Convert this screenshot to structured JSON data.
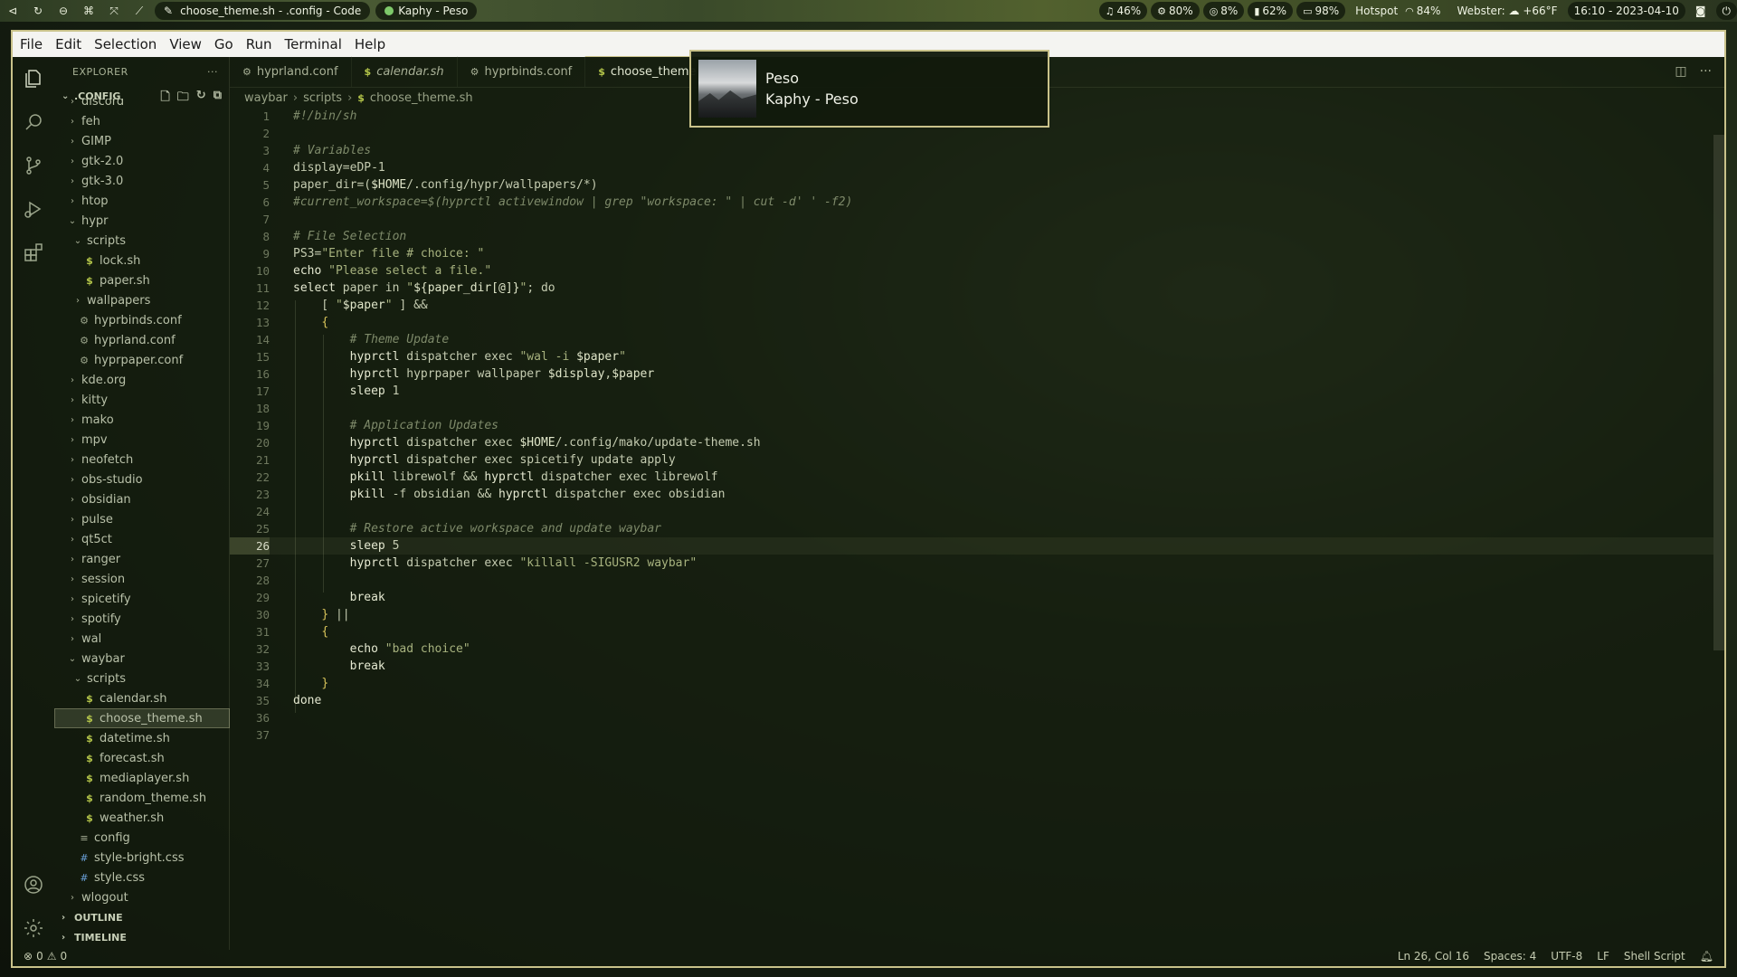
{
  "topbar": {
    "window_title": "choose_theme.sh - .config - Code",
    "player": "Kaphy - Peso",
    "modules": [
      {
        "name": "headphones",
        "icon": "♫",
        "value": "46%"
      },
      {
        "name": "cpu",
        "icon": "⚙",
        "value": "80%"
      },
      {
        "name": "memory",
        "icon": "◎",
        "value": "8%"
      },
      {
        "name": "disk",
        "icon": "▮",
        "value": "62%"
      },
      {
        "name": "battery",
        "icon": "▭",
        "value": "98%"
      }
    ],
    "hotspot": "Hotspot",
    "wifi": "84%",
    "weather": "Webster: ☁ +66°F",
    "datetime": "16:10 - 2023-04-10"
  },
  "menu": [
    "File",
    "Edit",
    "Selection",
    "View",
    "Go",
    "Run",
    "Terminal",
    "Help"
  ],
  "sidebar": {
    "header": "EXPLORER",
    "root": ".CONFIG",
    "outline": "OUTLINE",
    "timeline": "TIMELINE",
    "tree": [
      {
        "label": "discord",
        "indent": 0,
        "type": "folder",
        "open": false
      },
      {
        "label": "feh",
        "indent": 0,
        "type": "folder",
        "open": false
      },
      {
        "label": "GIMP",
        "indent": 0,
        "type": "folder",
        "open": false
      },
      {
        "label": "gtk-2.0",
        "indent": 0,
        "type": "folder",
        "open": false
      },
      {
        "label": "gtk-3.0",
        "indent": 0,
        "type": "folder",
        "open": false
      },
      {
        "label": "htop",
        "indent": 0,
        "type": "folder",
        "open": false
      },
      {
        "label": "hypr",
        "indent": 0,
        "type": "folder",
        "open": true
      },
      {
        "label": "scripts",
        "indent": 1,
        "type": "folder",
        "open": true
      },
      {
        "label": "lock.sh",
        "indent": 2,
        "type": "sh"
      },
      {
        "label": "paper.sh",
        "indent": 2,
        "type": "sh"
      },
      {
        "label": "wallpapers",
        "indent": 1,
        "type": "folder",
        "open": false
      },
      {
        "label": "hyprbinds.conf",
        "indent": 1,
        "type": "gear"
      },
      {
        "label": "hyprland.conf",
        "indent": 1,
        "type": "gear"
      },
      {
        "label": "hyprpaper.conf",
        "indent": 1,
        "type": "gear"
      },
      {
        "label": "kde.org",
        "indent": 0,
        "type": "folder",
        "open": false
      },
      {
        "label": "kitty",
        "indent": 0,
        "type": "folder",
        "open": false
      },
      {
        "label": "mako",
        "indent": 0,
        "type": "folder",
        "open": false
      },
      {
        "label": "mpv",
        "indent": 0,
        "type": "folder",
        "open": false
      },
      {
        "label": "neofetch",
        "indent": 0,
        "type": "folder",
        "open": false
      },
      {
        "label": "obs-studio",
        "indent": 0,
        "type": "folder",
        "open": false
      },
      {
        "label": "obsidian",
        "indent": 0,
        "type": "folder",
        "open": false
      },
      {
        "label": "pulse",
        "indent": 0,
        "type": "folder",
        "open": false
      },
      {
        "label": "qt5ct",
        "indent": 0,
        "type": "folder",
        "open": false
      },
      {
        "label": "ranger",
        "indent": 0,
        "type": "folder",
        "open": false
      },
      {
        "label": "session",
        "indent": 0,
        "type": "folder",
        "open": false
      },
      {
        "label": "spicetify",
        "indent": 0,
        "type": "folder",
        "open": false
      },
      {
        "label": "spotify",
        "indent": 0,
        "type": "folder",
        "open": false
      },
      {
        "label": "wal",
        "indent": 0,
        "type": "folder",
        "open": false
      },
      {
        "label": "waybar",
        "indent": 0,
        "type": "folder",
        "open": true
      },
      {
        "label": "scripts",
        "indent": 1,
        "type": "folder",
        "open": true
      },
      {
        "label": "calendar.sh",
        "indent": 2,
        "type": "sh"
      },
      {
        "label": "choose_theme.sh",
        "indent": 2,
        "type": "sh",
        "selected": true
      },
      {
        "label": "datetime.sh",
        "indent": 2,
        "type": "sh"
      },
      {
        "label": "forecast.sh",
        "indent": 2,
        "type": "sh"
      },
      {
        "label": "mediaplayer.sh",
        "indent": 2,
        "type": "sh"
      },
      {
        "label": "random_theme.sh",
        "indent": 2,
        "type": "sh"
      },
      {
        "label": "weather.sh",
        "indent": 2,
        "type": "sh"
      },
      {
        "label": "config",
        "indent": 1,
        "type": "conf"
      },
      {
        "label": "style-bright.css",
        "indent": 1,
        "type": "css"
      },
      {
        "label": "style.css",
        "indent": 1,
        "type": "css"
      },
      {
        "label": "wlogout",
        "indent": 0,
        "type": "folder",
        "open": false
      }
    ]
  },
  "tabs": [
    {
      "label": "hyprland.conf",
      "icon": "gear",
      "italic": false
    },
    {
      "label": "calendar.sh",
      "icon": "sh",
      "italic": true
    },
    {
      "label": "hyprbinds.conf",
      "icon": "gear",
      "italic": false
    },
    {
      "label": "choose_theme",
      "icon": "sh",
      "italic": false,
      "active": true
    }
  ],
  "breadcrumb": [
    "waybar",
    "scripts",
    "choose_theme.sh"
  ],
  "current_line": 26,
  "code": [
    "#!/bin/sh",
    "",
    "# Variables",
    "display=eDP-1",
    "paper_dir=($HOME/.config/hypr/wallpapers/*)",
    "#current_workspace=$(hyprctl activewindow | grep \"workspace: \" | cut -d' ' -f2)",
    "",
    "# File Selection",
    "PS3=\"Enter file # choice: \"",
    "echo \"Please select a file.\"",
    "select paper in \"${paper_dir[@]}\"; do",
    "    [ \"$paper\" ] &&",
    "    {",
    "        # Theme Update",
    "        hyprctl dispatcher exec \"wal -i $paper\"",
    "        hyprctl hyprpaper wallpaper $display,$paper",
    "        sleep 1",
    "",
    "        # Application Updates",
    "        hyprctl dispatcher exec $HOME/.config/mako/update-theme.sh",
    "        hyprctl dispatcher exec spicetify update apply",
    "        pkill librewolf && hyprctl dispatcher exec librewolf",
    "        pkill -f obsidian && hyprctl dispatcher exec obsidian",
    "",
    "        # Restore active workspace and update waybar",
    "        sleep 5",
    "        hyprctl dispatcher exec \"killall -SIGUSR2 waybar\"",
    "",
    "        break",
    "    } ||",
    "    {",
    "        echo \"bad choice\"",
    "        break",
    "    }",
    "done",
    "",
    ""
  ],
  "notification": {
    "title": "Peso",
    "body": "Kaphy - Peso"
  },
  "status": {
    "errors": "0",
    "warnings": "0",
    "position": "Ln 26, Col 16",
    "spaces": "Spaces: 4",
    "encoding": "UTF-8",
    "eol": "LF",
    "language": "Shell Script"
  }
}
